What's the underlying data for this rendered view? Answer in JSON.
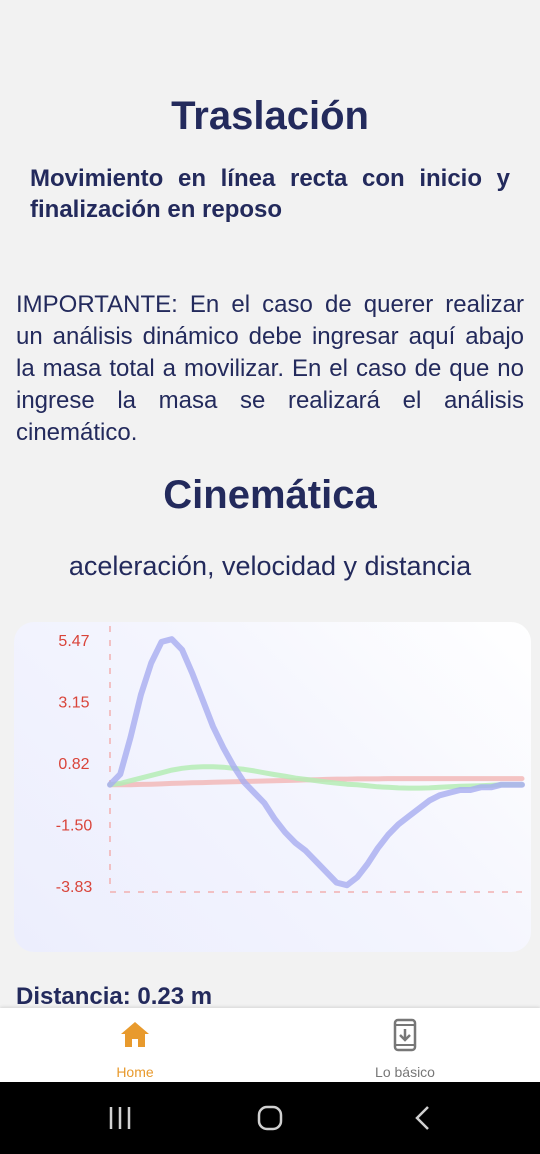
{
  "page": {
    "title": "Traslación",
    "subtitle": "Movimiento en línea recta con inicio y finalización en reposo",
    "important": "IMPORTANTE: En el caso de querer realizar un análisis dinámico debe ingresar aquí abajo la masa total a movilizar. En el caso de que no ingrese la masa se realizará el análisis cinemático.",
    "section_title": "Cinemática",
    "section_subtitle": "aceleración, velocidad y distancia",
    "distance": "Distancia: 0.23 m"
  },
  "chart_data": {
    "type": "line",
    "title": "",
    "xlabel": "",
    "ylabel": "",
    "y_ticks": [
      "5.47",
      "3.15",
      "0.82",
      "-1.50",
      "-3.83"
    ],
    "ylim": [
      -3.83,
      5.47
    ],
    "x": [
      0,
      1,
      2,
      3,
      4,
      5,
      6,
      7,
      8,
      9,
      10,
      11,
      12,
      13,
      14,
      15,
      16,
      17,
      18,
      19,
      20,
      21,
      22,
      23,
      24,
      25,
      26,
      27,
      28,
      29,
      30,
      31,
      32,
      33,
      34,
      35,
      36,
      37,
      38,
      39,
      40
    ],
    "grid": false,
    "colors": {
      "acceleration": "#a7acf0",
      "velocity": "#b5ecb5",
      "distance": "#f2b9b9"
    },
    "series": [
      {
        "key": "acceleration",
        "values": [
          0.0,
          0.4,
          1.8,
          3.4,
          4.6,
          5.4,
          5.5,
          5.1,
          4.2,
          3.2,
          2.2,
          1.4,
          0.7,
          0.1,
          -0.3,
          -0.7,
          -1.3,
          -1.8,
          -2.2,
          -2.5,
          -2.9,
          -3.3,
          -3.7,
          -3.8,
          -3.5,
          -3.0,
          -2.4,
          -1.9,
          -1.5,
          -1.2,
          -0.9,
          -0.6,
          -0.4,
          -0.3,
          -0.2,
          -0.2,
          -0.1,
          -0.1,
          0.0,
          0.0,
          0.0
        ]
      },
      {
        "key": "velocity",
        "values": [
          0.0,
          0.05,
          0.15,
          0.25,
          0.35,
          0.45,
          0.55,
          0.62,
          0.66,
          0.68,
          0.68,
          0.66,
          0.62,
          0.58,
          0.52,
          0.45,
          0.38,
          0.32,
          0.25,
          0.2,
          0.15,
          0.1,
          0.06,
          0.02,
          0.0,
          -0.04,
          -0.08,
          -0.1,
          -0.12,
          -0.13,
          -0.13,
          -0.12,
          -0.1,
          -0.08,
          -0.06,
          -0.05,
          -0.04,
          -0.02,
          0.0,
          0.0,
          0.0
        ]
      },
      {
        "key": "distance",
        "values": [
          0.0,
          0.0,
          0.0,
          0.01,
          0.02,
          0.03,
          0.05,
          0.06,
          0.07,
          0.08,
          0.09,
          0.1,
          0.11,
          0.12,
          0.13,
          0.14,
          0.15,
          0.16,
          0.17,
          0.18,
          0.19,
          0.2,
          0.21,
          0.21,
          0.22,
          0.22,
          0.22,
          0.23,
          0.23,
          0.23,
          0.23,
          0.23,
          0.23,
          0.23,
          0.23,
          0.23,
          0.23,
          0.23,
          0.23,
          0.23,
          0.23
        ]
      }
    ]
  },
  "bottom_nav": {
    "items": [
      {
        "label": "Home",
        "icon": "home-icon",
        "active": true,
        "color": "#e89a2d"
      },
      {
        "label": "Lo básico",
        "icon": "phone-download-icon",
        "active": false,
        "color": "#777777"
      }
    ]
  },
  "system_nav": {
    "buttons": [
      "recent-apps-icon",
      "home-circle-icon",
      "back-icon"
    ]
  }
}
